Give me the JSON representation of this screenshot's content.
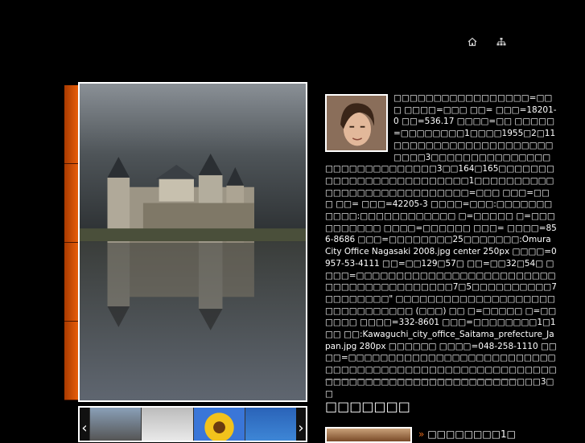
{
  "header": {
    "icons": [
      "home-icon",
      "sitemap-icon"
    ]
  },
  "article": {
    "text": "□□□□□□□□□□□□□□□□□=□□□ □□□□=□□□ □□= □□□=18201-0 □□=536.17 □□□□=□□ □□□□□=□□□□□□□□1□□□□1955□2□11□□□□□□□□□□□□□□□□□□□□□□□□3□□□□□□□□□□□□□□□□□□□□□□□□□□□□□3□□164□165□□□□□□□□□□□□□□□□□□□□□□□□□1□□□□□□□□□□□□□□□□□□□□□□□□□□□□=□□□ □□□=□□□ □□= □□□=42205-3 □□□□=□□□:□□□□□□□□□□□:□□□□□□□□□□□□ □=□□□□□ □=□□□ □□□□□□□ □□□□=□□□□□□ □□□= □□□□=856-8686 □□□=□□□□□□□□25□□□□□□□:Omura City Office Nagasaki 2008.jpg center 250px □□□□=0957-53-4111 □□=□□129□57□ □□=□□32□54□ □□□□=□□□□□□□□□□□□□□□□□□□□□□□□□□□□□□□□□□□□□□□□□7□5□□□□□□□□□□7□□□□□□□□\" □□□□□□□□□□□□□□□□□□□□□□□□□□□□□□□ (□□□) □□ □=□□□□□ □=□□□□□□ □□□□=332-8601 □□□=□□□□□□□□1□1□□ □□:Kawaguchi_city_office_Saitama_prefecture_Japan.jpg 280px □□□□□□ □□□□=048-258-1110 □□□□=□□□□□□□□□□□□□□□□□□□□□□□□□□□□□□□□□□□□□□□□□□□□□□□□□□□□□□□□□□□□□□□□□□□□□□□□□□□□□□□□□□3□□"
  },
  "section": {
    "title": "□□□□□□□"
  },
  "news": {
    "items": [
      {
        "label": "□□□□□□□□1□"
      }
    ]
  }
}
